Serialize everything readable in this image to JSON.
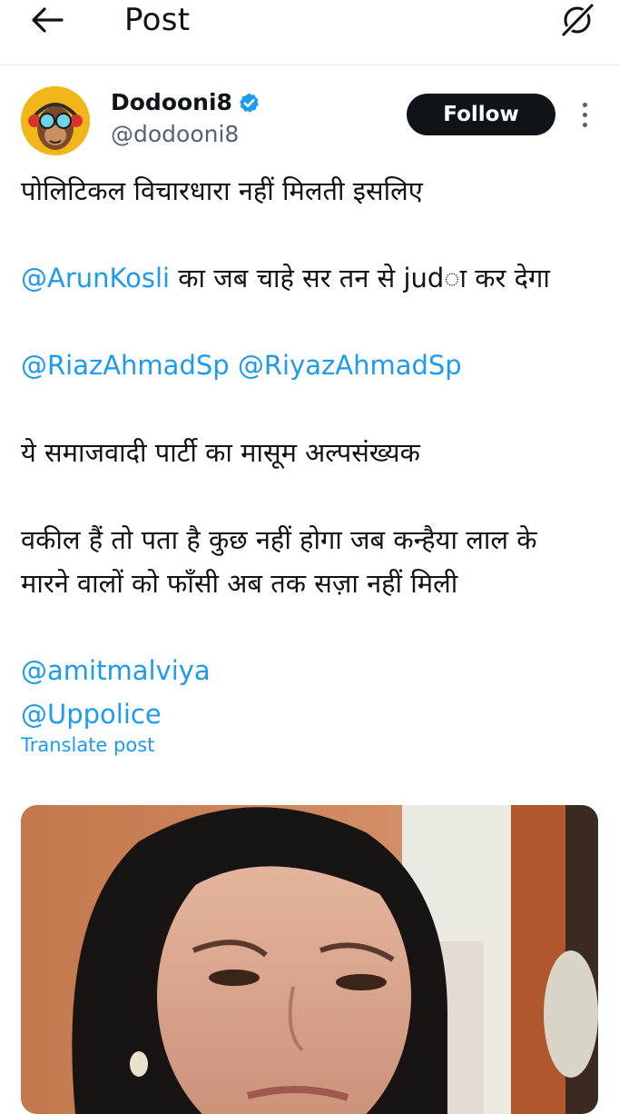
{
  "header": {
    "title": "Post",
    "back_icon": "arrow-left-icon",
    "grok_icon": "grok-icon"
  },
  "author": {
    "name": "Dodooni8",
    "handle": "@dodooni8",
    "verified": true,
    "follow_label": "Follow"
  },
  "post": {
    "line1": "पोलिटिकल विचारधारा नहीं मिलती इसलिए",
    "line2_mention": "@ArunKosli",
    "line2_text": " का जब चाहे सर तन से judा कर देगा",
    "mention3a": "@RiazAhmadSp",
    "mention3b": "@RiyazAhmadSp",
    "line4": "ये समाजवादी पार्टी का मासूम अल्पसंख्यक",
    "line5": "वकील हैं तो पता है कुछ नहीं होगा जब कन्हैया लाल के",
    "line6": "मारने वालों को फाँसी अब तक सज़ा नहीं मिली",
    "mention7": "@amitmalviya",
    "mention8": "@Uppolice",
    "translate_label": "Translate post"
  },
  "colors": {
    "link": "#1d9bf0",
    "text": "#0f1419",
    "secondary": "#536471",
    "follow_bg": "#0f1419"
  }
}
